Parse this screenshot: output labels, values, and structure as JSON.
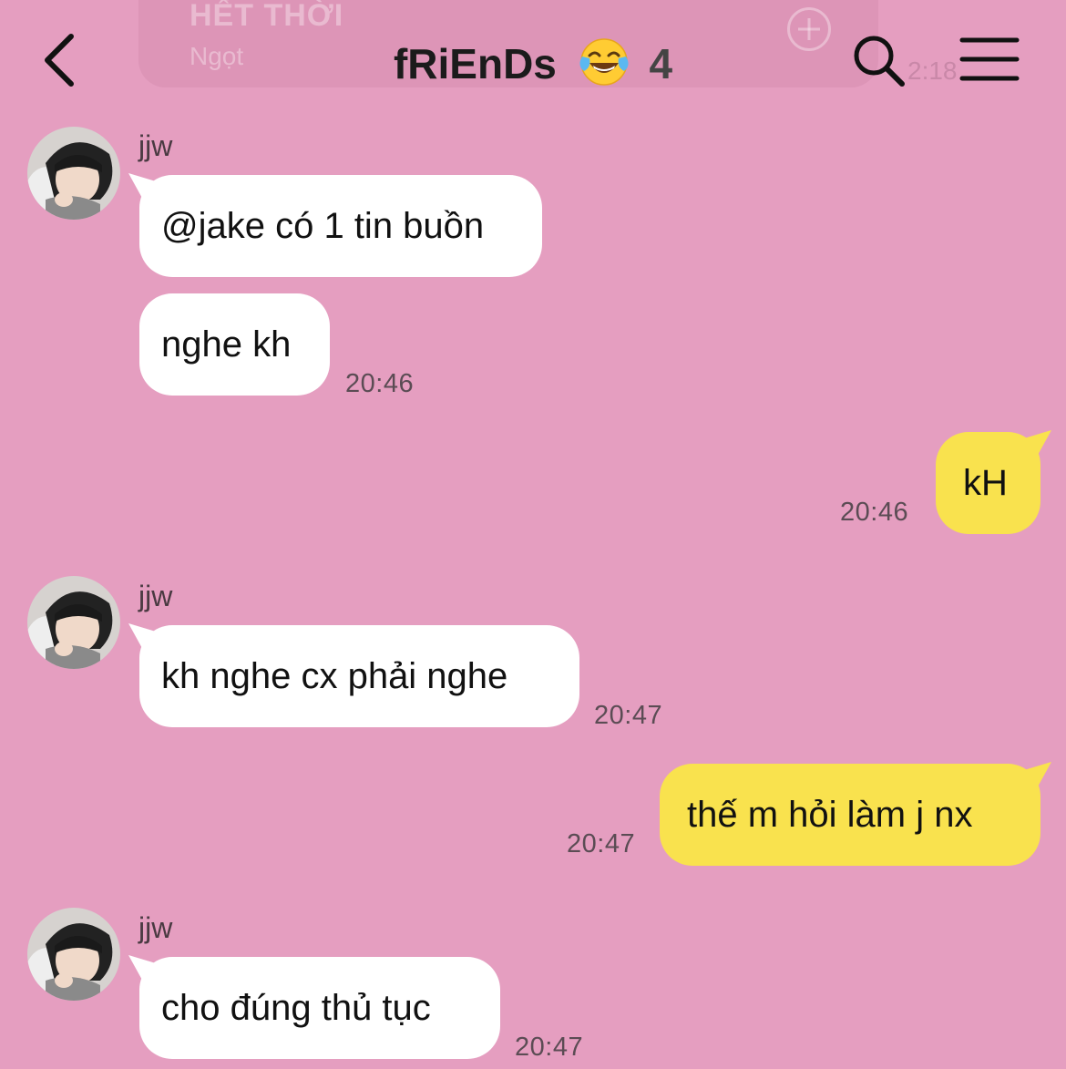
{
  "pinned": {
    "title": "HẾT THỜI",
    "subtitle": "Ngọt",
    "time": "2:18"
  },
  "header": {
    "title": "fRiEnDs",
    "emoji": "face-with-tears-of-joy",
    "member_count": "4"
  },
  "messages": [
    {
      "sender": "jjw",
      "text": "@jake có 1 tin buồn"
    },
    {
      "text": "nghe kh",
      "time": "20:46"
    },
    {
      "text": "kH",
      "time": "20:46"
    },
    {
      "sender": "jjw",
      "text": "kh nghe cx phải nghe",
      "time": "20:47"
    },
    {
      "text": "thế m hỏi làm j nx",
      "time": "20:47"
    },
    {
      "sender": "jjw",
      "text": "cho đúng thủ tục",
      "time": "20:47"
    }
  ],
  "colors": {
    "background": "#e59ec0",
    "incoming_bubble": "#ffffff",
    "outgoing_bubble": "#f9e24e"
  }
}
